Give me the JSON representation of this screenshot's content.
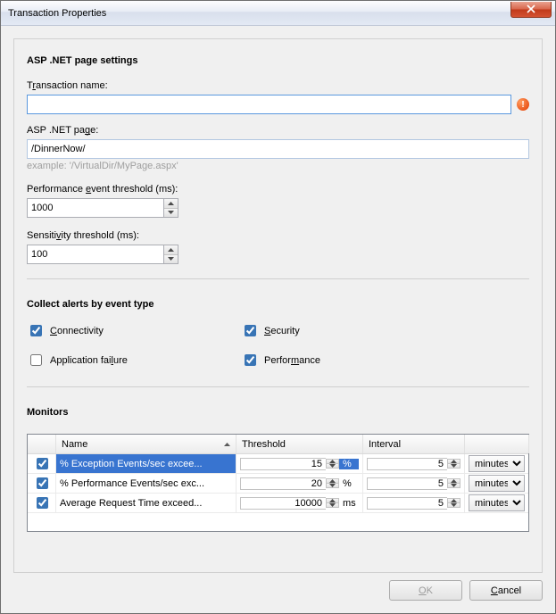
{
  "window": {
    "title": "Transaction Properties"
  },
  "section_settings": "ASP .NET page settings",
  "labels": {
    "transaction_name_pre": "T",
    "transaction_name_u": "r",
    "transaction_name_post": "ansaction name:",
    "asp_page_pre": "ASP .NET pa",
    "asp_page_u": "g",
    "asp_page_post": "e:",
    "asp_page_hint": "example: '/VirtualDir/MyPage.aspx'",
    "perf_pre": "Performance ",
    "perf_u": "e",
    "perf_post": "vent threshold (ms):",
    "sens_pre": "Sensiti",
    "sens_u": "v",
    "sens_post": "ity threshold (ms):"
  },
  "inputs": {
    "transaction_name": "",
    "asp_page": "/DinnerNow/",
    "perf_threshold": "1000",
    "sens_threshold": "100"
  },
  "section_alerts": "Collect alerts by event type",
  "checks": {
    "connectivity_pre": "",
    "connectivity_u": "C",
    "connectivity_post": "onnectivity",
    "security_pre": "",
    "security_u": "S",
    "security_post": "ecurity",
    "appfail_pre": "Application fai",
    "appfail_u": "l",
    "appfail_post": "ure",
    "performance_pre": "Perfor",
    "performance_u": "m",
    "performance_post": "ance"
  },
  "section_monitors": "Monitors",
  "grid": {
    "headers": {
      "name": "Name",
      "threshold": "Threshold",
      "interval": "Interval"
    },
    "rows": [
      {
        "enabled": true,
        "name": "% Exception Events/sec excee...",
        "threshold": "15",
        "unit": "%",
        "interval": "5",
        "interval_unit": "minutes"
      },
      {
        "enabled": true,
        "name": "% Performance Events/sec exc...",
        "threshold": "20",
        "unit": "%",
        "interval": "5",
        "interval_unit": "minutes"
      },
      {
        "enabled": true,
        "name": "Average Request Time exceed...",
        "threshold": "10000",
        "unit": "ms",
        "interval": "5",
        "interval_unit": "minutes"
      }
    ]
  },
  "buttons": {
    "ok_u": "O",
    "ok_post": "K",
    "cancel_u": "C",
    "cancel_post": "ancel"
  }
}
